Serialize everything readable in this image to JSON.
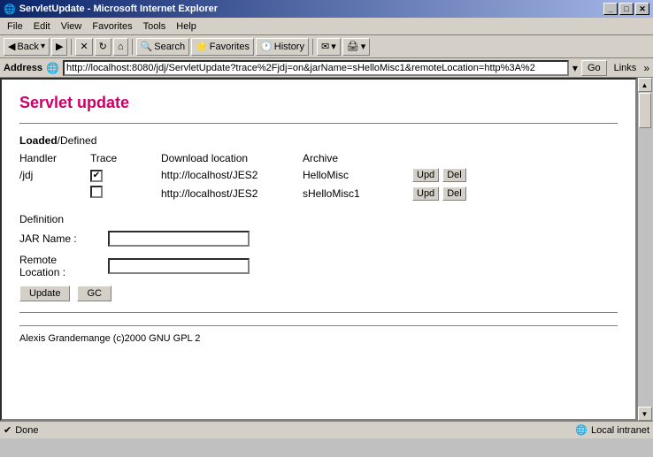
{
  "window": {
    "title": "ServletUpdate - Microsoft Internet Explorer",
    "title_icon": "🌐"
  },
  "title_buttons": {
    "minimize": "_",
    "maximize": "□",
    "close": "✕"
  },
  "menu": {
    "items": [
      "File",
      "Edit",
      "View",
      "Favorites",
      "Tools",
      "Help"
    ]
  },
  "toolbar": {
    "back": "Back",
    "forward": "▶",
    "stop": "✕",
    "refresh": "↻",
    "home": "⌂",
    "search": "Search",
    "favorites": "Favorites",
    "history": "History",
    "mail": "✉",
    "print": "🖨"
  },
  "address_bar": {
    "label": "Address",
    "url": "http://localhost:8080/jdj/ServletUpdate?trace%2Fjdj=on&jarName=sHelloMisc1&remoteLocation=http%3A%2",
    "go_btn": "Go",
    "links": "Links"
  },
  "page": {
    "title": "Servlet update",
    "loaded_label": "Loaded",
    "defined_label": "/Defined",
    "table": {
      "headers": {
        "handler": "Handler",
        "trace": "Trace",
        "download_location": "Download location",
        "archive": "Archive"
      },
      "rows": [
        {
          "handler": "/jdj",
          "trace_checked": true,
          "download": "http://localhost/JES2",
          "archive": "HelloMisc",
          "upd": "Upd",
          "del": "Del"
        },
        {
          "handler": "",
          "trace_checked": false,
          "download": "http://localhost/JES2",
          "archive": "sHelloMisc1",
          "upd": "Upd",
          "del": "Del"
        }
      ]
    },
    "definition": {
      "label": "Definition",
      "jar_name_label": "JAR Name :",
      "jar_name_value": "",
      "remote_location_label": "Remote Location :",
      "remote_location_value": "",
      "update_btn": "Update",
      "gc_btn": "GC"
    },
    "footer": "Alexis Grandemange (c)2000 GNU GPL 2"
  },
  "status_bar": {
    "left": "Done",
    "right": "Local intranet"
  }
}
